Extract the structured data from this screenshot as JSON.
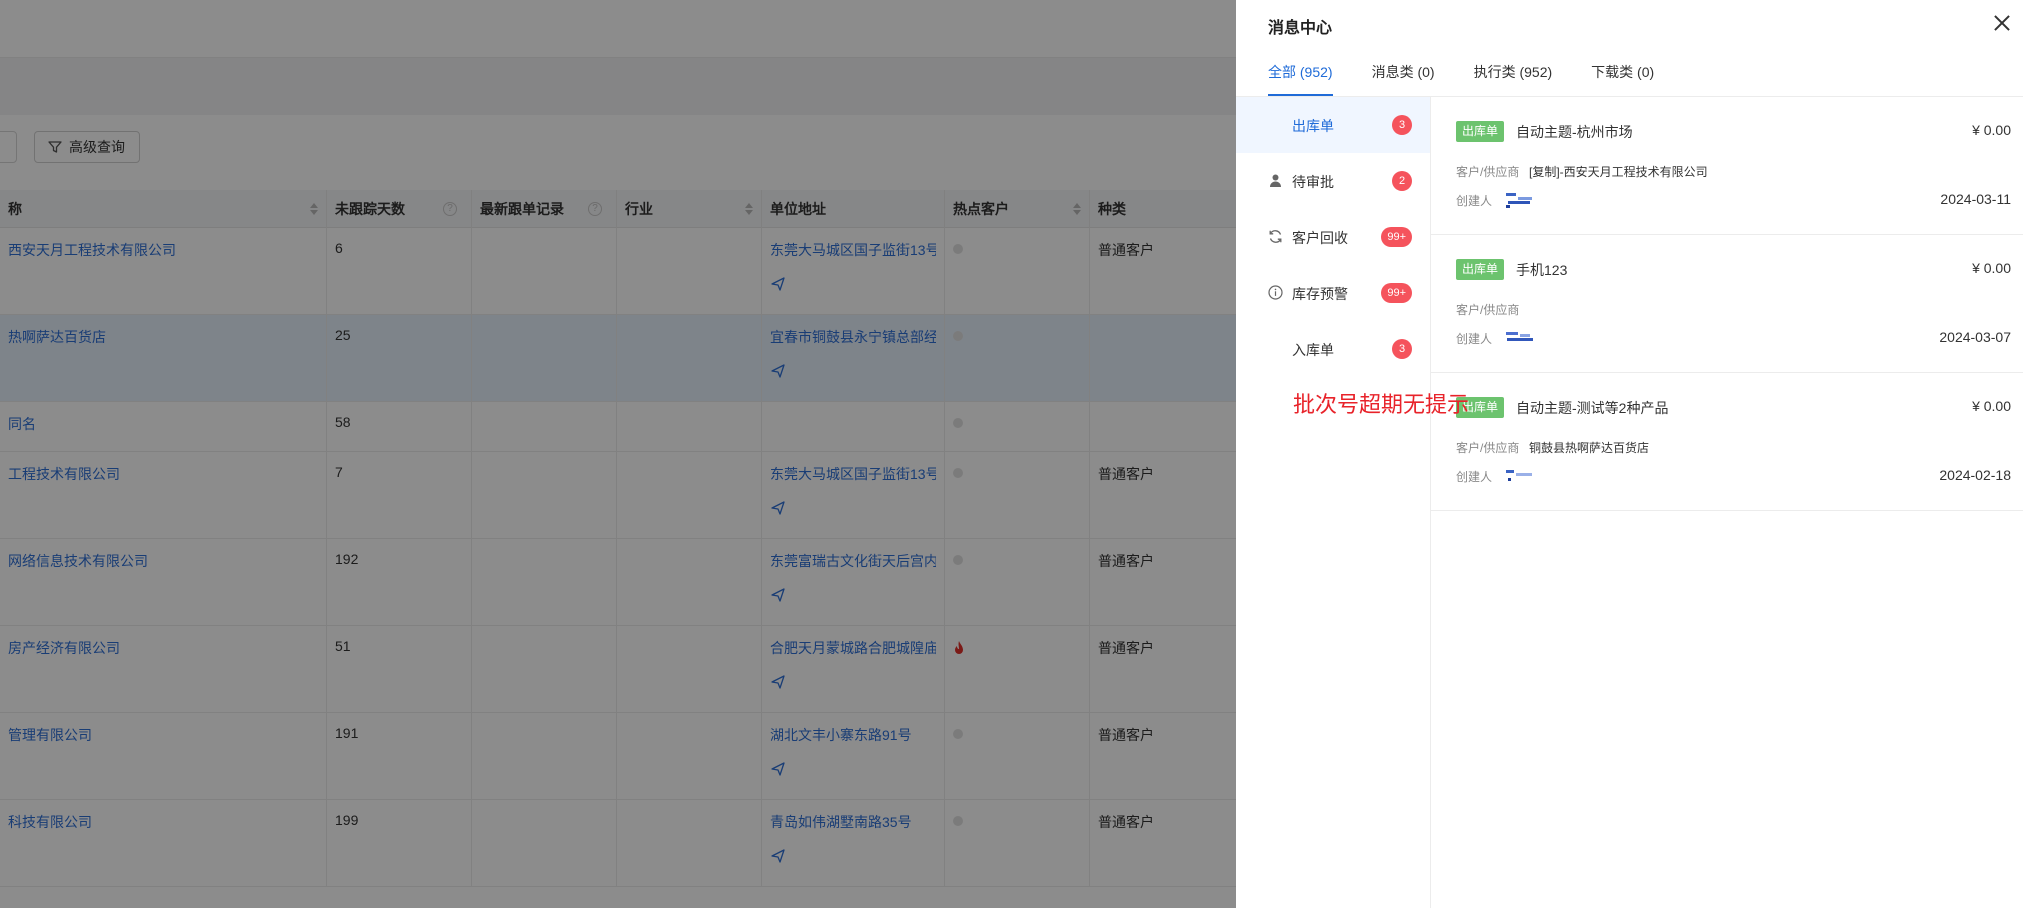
{
  "background": {
    "advanced_search_label": "高级查询",
    "columns": [
      "称",
      "未跟踪天数",
      "最新跟单记录",
      "行业",
      "单位地址",
      "热点客户",
      "种类"
    ],
    "rows": [
      {
        "name": "西安天月工程技术有限公司",
        "days": "6",
        "address": "东莞大马城区国子监街13号",
        "category": "普通客户"
      },
      {
        "name": "热啊萨达百货店",
        "days": "25",
        "address": "宜春市铜鼓县永宁镇总部经济",
        "category": ""
      },
      {
        "name": "同名",
        "days": "58",
        "address": "",
        "category": ""
      },
      {
        "name": "工程技术有限公司",
        "days": "7",
        "address": "东莞大马城区国子监街13号",
        "category": "普通客户"
      },
      {
        "name": "网络信息技术有限公司",
        "days": "192",
        "address": "东莞富瑞古文化街天后宫内",
        "category": "普通客户"
      },
      {
        "name": "房产经济有限公司",
        "days": "51",
        "address": "合肥天月蒙城路合肥城隍庙",
        "category": "普通客户"
      },
      {
        "name": "管理有限公司",
        "days": "191",
        "address": "湖北文丰小寨东路91号",
        "category": "普通客户"
      },
      {
        "name": "科技有限公司",
        "days": "199",
        "address": "青岛如伟湖墅南路35号",
        "category": "普通客户"
      }
    ]
  },
  "drawer": {
    "title": "消息中心",
    "tabs": [
      {
        "label": "全部 (952)",
        "active": true
      },
      {
        "label": "消息类 (0)",
        "active": false
      },
      {
        "label": "执行类 (952)",
        "active": false
      },
      {
        "label": "下载类 (0)",
        "active": false
      }
    ],
    "side_items": [
      {
        "label": "出库单",
        "count": "3",
        "icon": "none",
        "active": true
      },
      {
        "label": "待审批",
        "count": "2",
        "icon": "user-icon",
        "active": false
      },
      {
        "label": "客户回收",
        "count": "99+",
        "icon": "refresh-icon",
        "active": false
      },
      {
        "label": "库存预警",
        "count": "99+",
        "icon": "info-icon",
        "active": false
      },
      {
        "label": "入库单",
        "count": "3",
        "icon": "none",
        "active": false
      }
    ],
    "cards": [
      {
        "tag": "出库单",
        "title": "自动主题-杭州市场",
        "amount": "¥ 0.00",
        "supplier_label": "客户/供应商",
        "supplier": "[复制]-西安天月工程技术有限公司",
        "creator_label": "创建人",
        "date": "2024-03-11"
      },
      {
        "tag": "出库单",
        "title": "手机123",
        "amount": "¥ 0.00",
        "supplier_label": "客户/供应商",
        "supplier": "",
        "creator_label": "创建人",
        "date": "2024-03-07"
      },
      {
        "tag": "出库单",
        "title": "自动主题-测试等2种产品",
        "amount": "¥ 0.00",
        "supplier_label": "客户/供应商",
        "supplier": "铜鼓县热啊萨达百货店",
        "creator_label": "创建人",
        "date": "2024-02-18"
      }
    ]
  },
  "toast": "批次号超期无提示",
  "colors": {
    "accent": "#1f6bd8",
    "tag_green": "#6cc36e",
    "badge_red": "#f5535c",
    "toast_red": "#e8232a",
    "link_blue": "#2f6fd6"
  }
}
